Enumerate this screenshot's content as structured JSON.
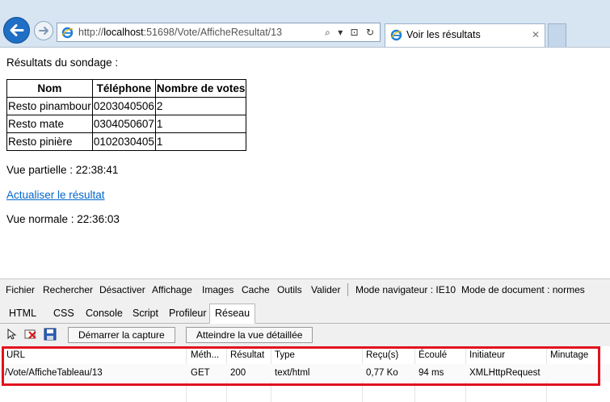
{
  "browser": {
    "url_prefix": "http://",
    "url_host": "localhost",
    "url_rest": ":51698/Vote/AfficheResultat/13",
    "address_tools": "⌕ ▾ ⊡ ↻",
    "tab_title": "Voir les résultats",
    "tab_close": "✕"
  },
  "page": {
    "heading": "Résultats du sondage :",
    "table": {
      "headers": [
        "Nom",
        "Téléphone",
        "Nombre de votes"
      ],
      "rows": [
        [
          "Resto pinambour",
          "0203040506",
          "2"
        ],
        [
          "Resto mate",
          "0304050607",
          "1"
        ],
        [
          "Resto pinière",
          "0102030405",
          "1"
        ]
      ]
    },
    "partial_view": "Vue partielle : 22:38:41",
    "refresh_link": "Actualiser le résultat",
    "normal_view": "Vue normale : 22:36:03"
  },
  "devtools": {
    "menu": [
      "Fichier",
      "Rechercher",
      "Désactiver",
      "Affichage",
      "Images",
      "Cache",
      "Outils",
      "Valider",
      "Mode navigateur : IE10",
      "Mode de document : normes"
    ],
    "tabs": [
      "HTML",
      "CSS",
      "Console",
      "Script",
      "Profileur",
      "Réseau"
    ],
    "active_tab": "Réseau",
    "toolbar": {
      "start_capture": "Démarrer la capture",
      "detailed_view": "Atteindre la vue détaillée"
    },
    "network": {
      "columns": [
        "URL",
        "Méth...",
        "Résultat",
        "Type",
        "Reçu(s)",
        "Écoulé",
        "Initiateur",
        "Minutage"
      ],
      "rows": [
        [
          "/Vote/AfficheTableau/13",
          "GET",
          "200",
          "text/html",
          "0,77 Ko",
          "94 ms",
          "XMLHttpRequest",
          ""
        ]
      ]
    }
  },
  "colors": {
    "highlight_box": "#e1121d",
    "link": "#0066cc",
    "back_button": "#1e6fc5"
  }
}
